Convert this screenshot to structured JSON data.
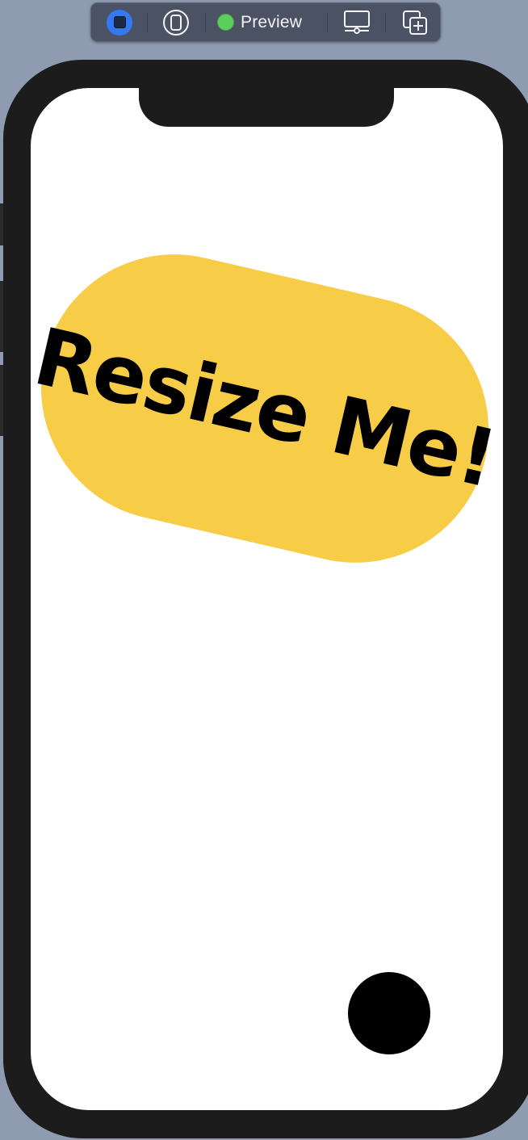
{
  "toolbar": {
    "live_icon": "live-preview-icon",
    "device_icon": "device-select-icon",
    "preview_label": "Preview",
    "preview_status_color": "#5ccf5b",
    "device_settings_icon": "device-settings-icon",
    "duplicate_icon": "duplicate-preview-icon"
  },
  "content": {
    "shape_label": "Resize Me!",
    "shape_color": "#f7cd48",
    "handle_color": "#000000"
  }
}
